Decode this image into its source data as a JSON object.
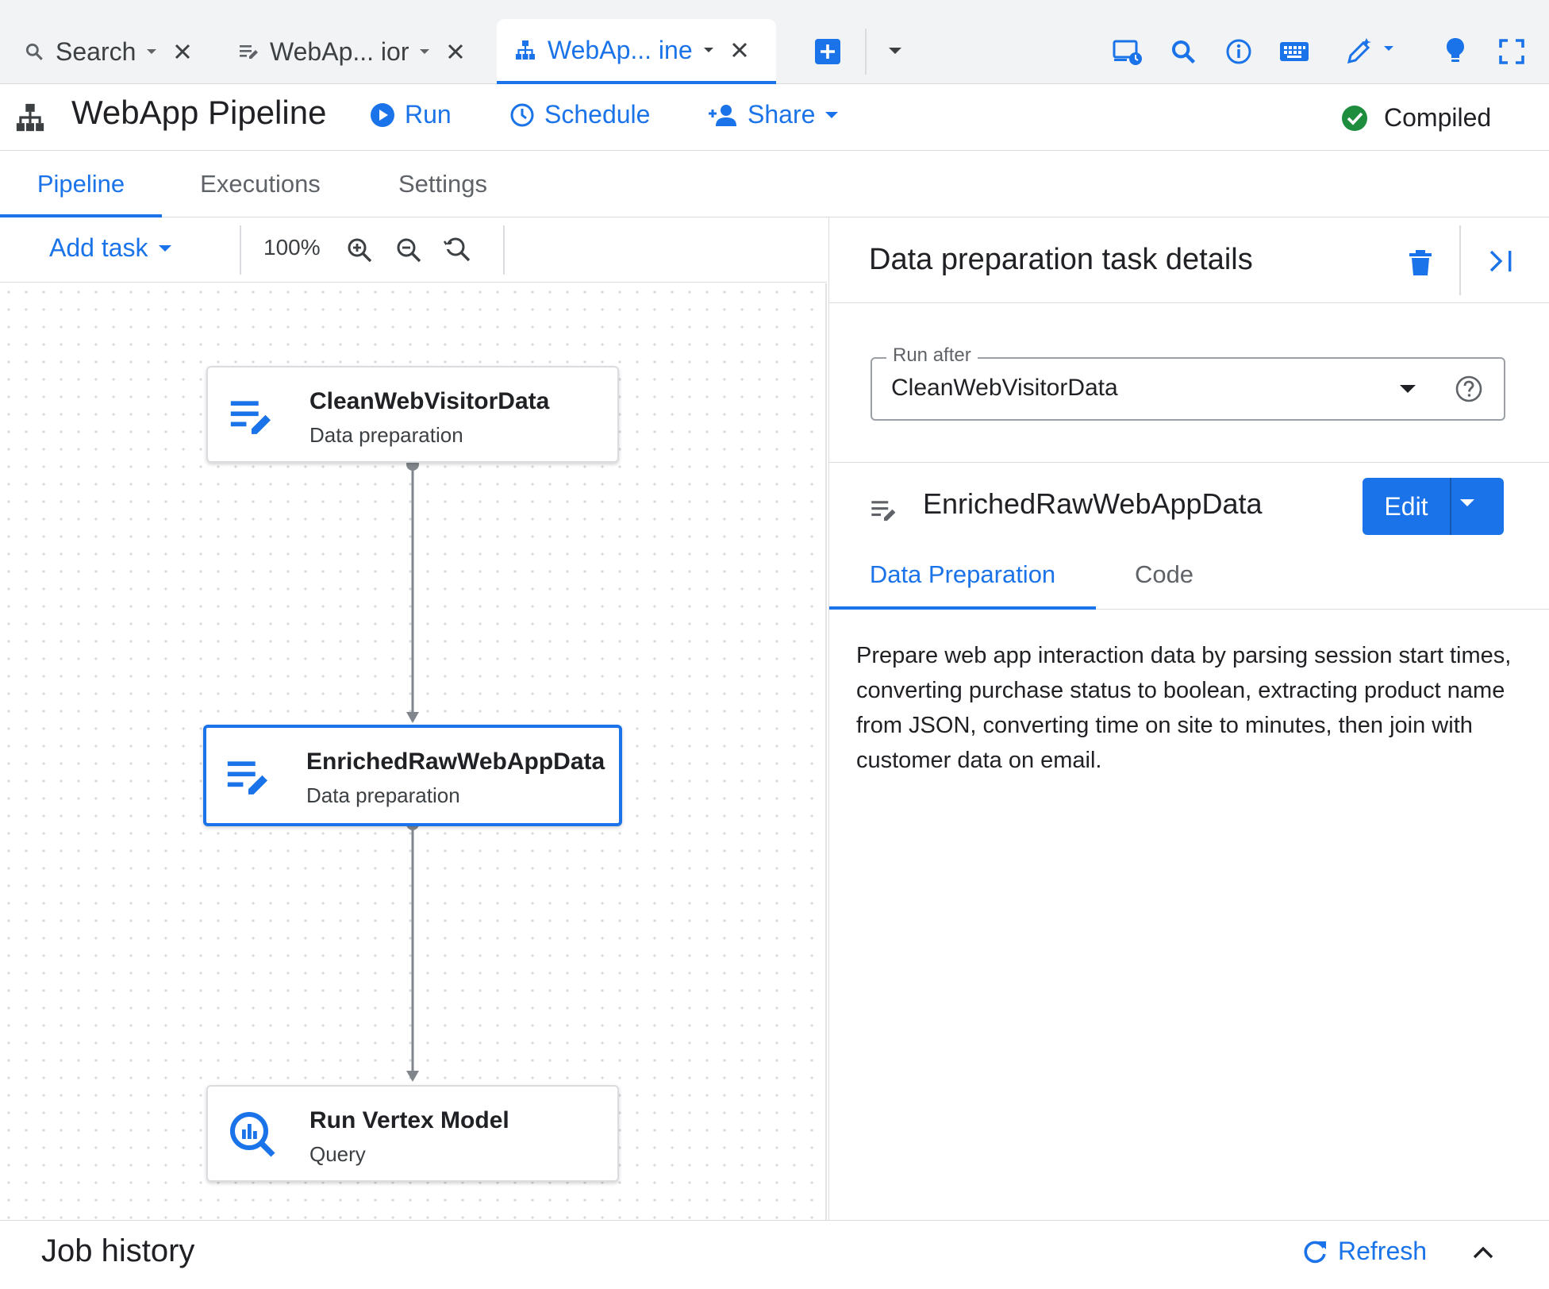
{
  "tabbar": {
    "tabs": [
      {
        "label": "Search",
        "icon": "search-icon"
      },
      {
        "label": "WebAp... ior",
        "icon": "data-prep-icon"
      },
      {
        "label": "WebAp... ine",
        "icon": "pipeline-icon",
        "active": true
      }
    ],
    "actions": [
      "add-tab-icon",
      "more-tabs-icon",
      "compute-icon",
      "search-icon",
      "info-icon",
      "keyboard-icon",
      "magic-edit-icon",
      "lightbulb-icon",
      "fullscreen-icon"
    ]
  },
  "header": {
    "title": "WebApp Pipeline",
    "run_label": "Run",
    "schedule_label": "Schedule",
    "share_label": "Share",
    "status_label": "Compiled"
  },
  "pipeline_tabs": [
    "Pipeline",
    "Executions",
    "Settings"
  ],
  "toolbar": {
    "add_task_label": "Add task",
    "zoom_level": "100%"
  },
  "nodes": [
    {
      "title": "CleanWebVisitorData",
      "subtitle": "Data preparation",
      "icon": "data-prep-icon"
    },
    {
      "title": "EnrichedRawWebAppData",
      "subtitle": "Data preparation",
      "icon": "data-prep-icon",
      "selected": true
    },
    {
      "title": "Run Vertex Model",
      "subtitle": "Query",
      "icon": "query-icon"
    }
  ],
  "details": {
    "title": "Data preparation task details",
    "run_after_label": "Run after",
    "run_after_value": "CleanWebVisitorData",
    "task_name": "EnrichedRawWebAppData",
    "edit_label": "Edit",
    "tabs": [
      "Data Preparation",
      "Code"
    ],
    "description": "Prepare web app interaction data by parsing session start times, converting purchase status to boolean, extracting product name from JSON, converting time on site to minutes, then join with customer data on email."
  },
  "footer": {
    "job_history_label": "Job history",
    "refresh_label": "Refresh"
  },
  "colors": {
    "accent": "#1a73e8",
    "success": "#1e8e3e",
    "border": "#dadce0"
  }
}
